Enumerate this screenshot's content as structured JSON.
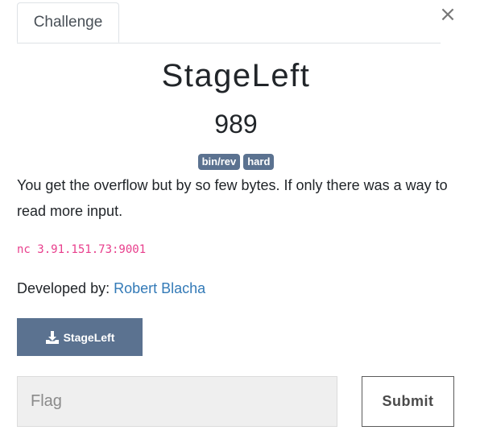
{
  "tabs": [
    {
      "label": "Challenge"
    }
  ],
  "close_symbol": "×",
  "challenge": {
    "name": "StageLeft",
    "value": "989",
    "tags": [
      "bin/rev",
      "hard"
    ],
    "description": "You get the overflow but by so few bytes. If only there was a way to read more input.",
    "connection_info": "nc 3.91.151.73:9001",
    "developer_prefix": "Developed by:",
    "developer_name": "Robert Blacha"
  },
  "download": {
    "label": "StageLeft",
    "icon": "download-icon"
  },
  "flag_form": {
    "placeholder": "Flag",
    "value": "",
    "submit_label": "Submit"
  },
  "colors": {
    "tag_bg": "#5b7290",
    "button_bg": "#5b7290",
    "link": "#337ab7",
    "code": "#e83e8c"
  }
}
